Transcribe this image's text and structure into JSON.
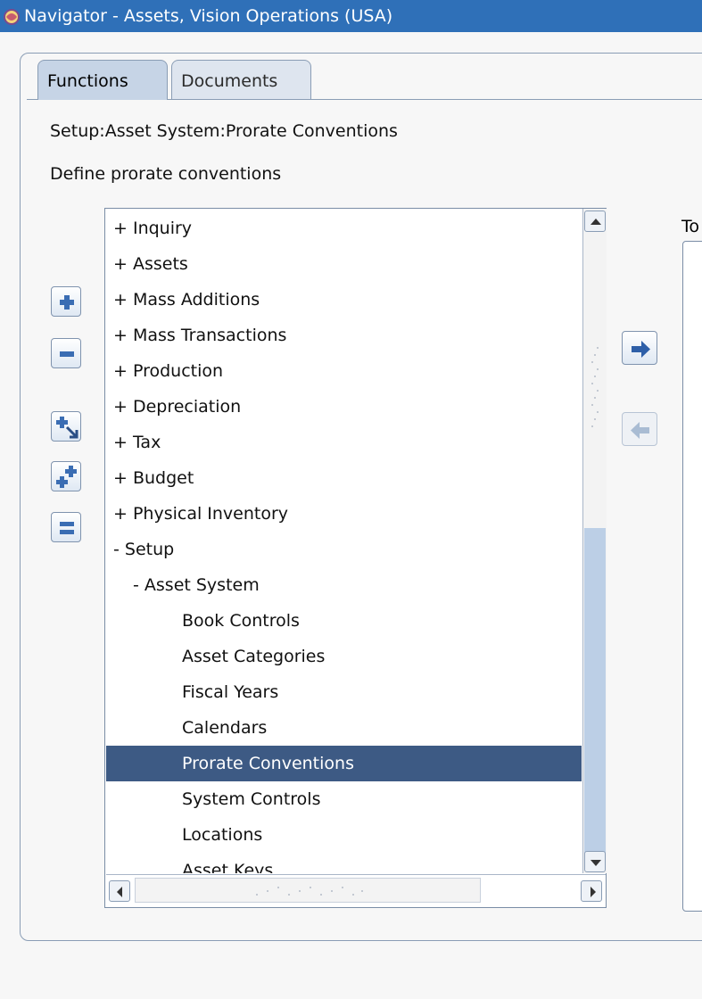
{
  "window": {
    "title": "Navigator - Assets, Vision Operations (USA)"
  },
  "tabs": [
    {
      "label": "Functions",
      "active": true
    },
    {
      "label": "Documents",
      "active": false
    }
  ],
  "selected_function": {
    "path": "Setup:Asset System:Prorate Conventions",
    "description": "Define prorate conventions"
  },
  "tree": {
    "items": [
      {
        "label": "+ Inquiry",
        "level": 0
      },
      {
        "label": "+ Assets",
        "level": 0
      },
      {
        "label": "+ Mass Additions",
        "level": 0
      },
      {
        "label": "+ Mass Transactions",
        "level": 0
      },
      {
        "label": "+ Production",
        "level": 0
      },
      {
        "label": "+ Depreciation",
        "level": 0
      },
      {
        "label": "+ Tax",
        "level": 0
      },
      {
        "label": "+ Budget",
        "level": 0
      },
      {
        "label": "+ Physical Inventory",
        "level": 0
      },
      {
        "label": "- Setup",
        "level": 0
      },
      {
        "label": "- Asset System",
        "level": 1
      },
      {
        "label": "Book Controls",
        "level": 2
      },
      {
        "label": "Asset Categories",
        "level": 2
      },
      {
        "label": "Fiscal Years",
        "level": 2
      },
      {
        "label": "Calendars",
        "level": 2
      },
      {
        "label": "Prorate Conventions",
        "level": 2,
        "selected": true
      },
      {
        "label": "System Controls",
        "level": 2
      },
      {
        "label": "Locations",
        "level": 2
      },
      {
        "label": "Asset Keys",
        "level": 2
      }
    ]
  },
  "toolbar": {
    "buttons": [
      {
        "icon": "expand-plus-icon"
      },
      {
        "icon": "collapse-minus-icon"
      },
      {
        "icon": "expand-branch-icon"
      },
      {
        "icon": "expand-all-icon"
      },
      {
        "icon": "collapse-all-icon"
      }
    ]
  },
  "transfer": {
    "add_icon": "arrow-right-icon",
    "remove_icon": "arrow-left-icon",
    "remove_enabled": false
  },
  "top_ten": {
    "label_visible": "To"
  },
  "colors": {
    "titlebar": "#2f70b8",
    "selection": "#3d5a84",
    "active_tab": "#c6d4e6"
  }
}
